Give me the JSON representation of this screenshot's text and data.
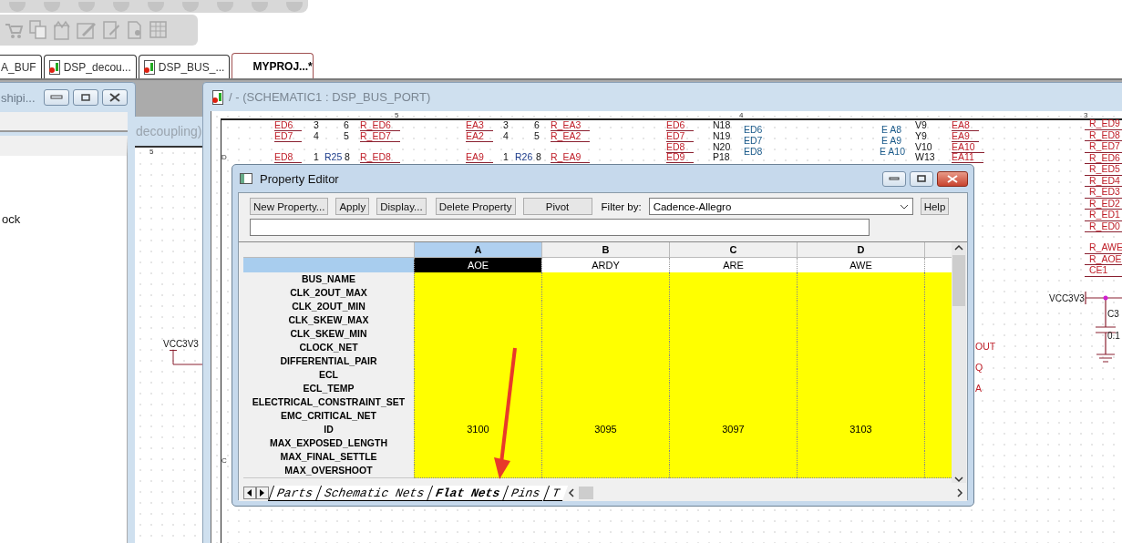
{
  "document_tabs": [
    {
      "label": "A_BUF",
      "icon": false,
      "selected": false
    },
    {
      "label": "DSP_decou...",
      "icon": true,
      "selected": false
    },
    {
      "label": "DSP_BUS_...",
      "icon": true,
      "selected": false
    },
    {
      "label": "MYPROJ...*",
      "icon": false,
      "selected": true
    }
  ],
  "left_window": {
    "title": "shipi...",
    "items": [
      "ock"
    ]
  },
  "middle_window": {
    "title": "decoupling)",
    "zone": "5",
    "power": "VCC3V3"
  },
  "schematic": {
    "title": "/ - (SCHEMATIC1 : DSP_BUS_PORT)",
    "zones": [
      "5",
      "4",
      "3"
    ],
    "rows_marks": [
      "D",
      "C"
    ],
    "labels": [
      {
        "t": "ED6",
        "kind": "net"
      },
      {
        "t": "3",
        "kind": "pin"
      },
      {
        "t": "6",
        "kind": "pin"
      },
      {
        "t": "R_ED6",
        "kind": "net"
      },
      {
        "t": "EA3",
        "kind": "net"
      },
      {
        "t": "3",
        "kind": "pin"
      },
      {
        "t": "6",
        "kind": "pin"
      },
      {
        "t": "R_EA3",
        "kind": "net"
      },
      {
        "t": "ED6",
        "kind": "net"
      },
      {
        "t": "N18",
        "kind": "pin"
      },
      {
        "t": "ED6",
        "kind": "bus"
      },
      {
        "t": "E A8",
        "kind": "bus"
      },
      {
        "t": "V9",
        "kind": "pin"
      },
      {
        "t": "EA8",
        "kind": "net"
      },
      {
        "t": "ED7",
        "kind": "net"
      },
      {
        "t": "4",
        "kind": "pin"
      },
      {
        "t": "5",
        "kind": "pin"
      },
      {
        "t": "R_ED7",
        "kind": "net"
      },
      {
        "t": "EA2",
        "kind": "net"
      },
      {
        "t": "4",
        "kind": "pin"
      },
      {
        "t": "5",
        "kind": "pin"
      },
      {
        "t": "R_EA2",
        "kind": "net"
      },
      {
        "t": "ED7",
        "kind": "net"
      },
      {
        "t": "N19",
        "kind": "pin"
      },
      {
        "t": "ED7",
        "kind": "bus"
      },
      {
        "t": "E A9",
        "kind": "bus"
      },
      {
        "t": "Y9",
        "kind": "pin"
      },
      {
        "t": "EA9",
        "kind": "net"
      },
      {
        "t": "ED8",
        "kind": "net"
      },
      {
        "t": "N20",
        "kind": "pin"
      },
      {
        "t": "ED8",
        "kind": "bus"
      },
      {
        "t": "E A10",
        "kind": "bus"
      },
      {
        "t": "V10",
        "kind": "pin"
      },
      {
        "t": "EA10",
        "kind": "net"
      },
      {
        "t": "ED8",
        "kind": "net"
      },
      {
        "t": "1",
        "kind": "pin"
      },
      {
        "t": "R25",
        "kind": "ref"
      },
      {
        "t": "8",
        "kind": "pin"
      },
      {
        "t": "R_ED8",
        "kind": "net"
      },
      {
        "t": "EA9",
        "kind": "net"
      },
      {
        "t": "1",
        "kind": "pin"
      },
      {
        "t": "R26",
        "kind": "ref"
      },
      {
        "t": "8",
        "kind": "pin"
      },
      {
        "t": "R_EA9",
        "kind": "net"
      },
      {
        "t": "ED9",
        "kind": "net"
      },
      {
        "t": "P18",
        "kind": "pin"
      },
      {
        "t": "W13",
        "kind": "pin"
      },
      {
        "t": "EA11",
        "kind": "net"
      }
    ],
    "right_nets": [
      [
        "R_ED9",
        "R_ED8",
        "R_ED7",
        "R_ED6",
        "R_ED5",
        "R_ED4",
        "R_ED3",
        "R_ED2",
        "R_ED1",
        "R_ED0"
      ],
      [
        "R_AWE",
        "R_AOE",
        "CE1"
      ]
    ],
    "edge_nets": [
      "OUT",
      "Q",
      "A"
    ],
    "power": "VCC3V3",
    "capacitor": "C3",
    "cap_value": "0.1"
  },
  "property_editor": {
    "title": "Property Editor",
    "buttons": [
      "New Property...",
      "Apply",
      "Display...",
      "Delete Property",
      "Pivot"
    ],
    "filter_label": "Filter by:",
    "filter_value": "Cadence-Allegro",
    "help": "Help",
    "columns": [
      {
        "letter": "A",
        "net": "AOE",
        "selected": true
      },
      {
        "letter": "B",
        "net": "ARDY",
        "selected": false
      },
      {
        "letter": "C",
        "net": "ARE",
        "selected": false
      },
      {
        "letter": "D",
        "net": "AWE",
        "selected": false
      }
    ],
    "rows": [
      {
        "name": "BUS_NAME"
      },
      {
        "name": "CLK_2OUT_MAX"
      },
      {
        "name": "CLK_2OUT_MIN"
      },
      {
        "name": "CLK_SKEW_MAX"
      },
      {
        "name": "CLK_SKEW_MIN"
      },
      {
        "name": "CLOCK_NET"
      },
      {
        "name": "DIFFERENTIAL_PAIR"
      },
      {
        "name": "ECL"
      },
      {
        "name": "ECL_TEMP"
      },
      {
        "name": "ELECTRICAL_CONSTRAINT_SET"
      },
      {
        "name": "EMC_CRITICAL_NET"
      },
      {
        "name": "ID",
        "values": [
          "3100",
          "3095",
          "3097",
          "3103"
        ]
      },
      {
        "name": "MAX_EXPOSED_LENGTH"
      },
      {
        "name": "MAX_FINAL_SETTLE"
      },
      {
        "name": "MAX_OVERSHOOT"
      }
    ],
    "sheet_tabs": [
      {
        "label": "Parts",
        "selected": false
      },
      {
        "label": "Schematic Nets",
        "selected": false
      },
      {
        "label": "Flat Nets",
        "selected": true
      },
      {
        "label": "Pins",
        "selected": false
      },
      {
        "label": "T",
        "selected": false
      }
    ]
  }
}
